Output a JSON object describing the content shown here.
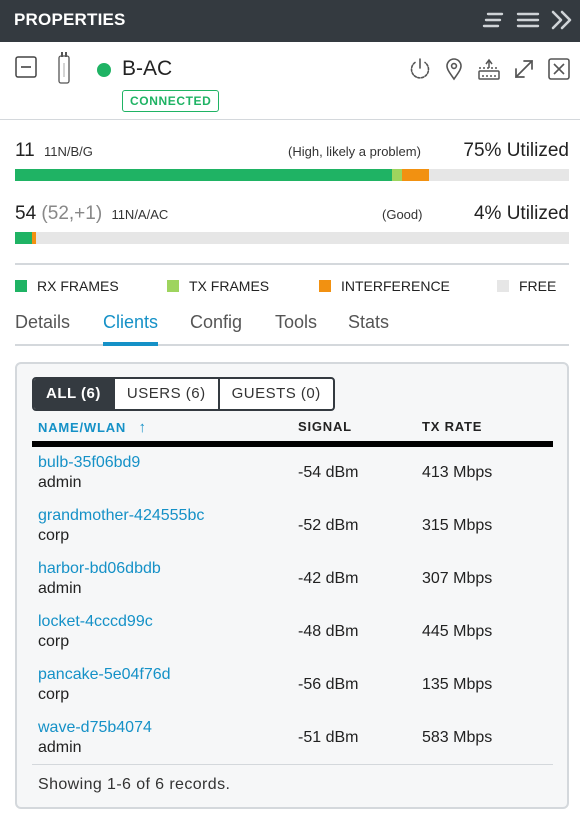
{
  "panel": {
    "title": "PROPERTIES"
  },
  "header_icons": [
    "list-filter-icon",
    "menu-icon",
    "double-chevron-right-icon"
  ],
  "device": {
    "name": "B-AC",
    "status": "CONNECTED",
    "status_color": "#1fb364",
    "actions": [
      "power-icon",
      "location-pin-icon",
      "network-switch-icon",
      "expand-icon",
      "close-icon"
    ]
  },
  "radios": [
    {
      "channel": "11",
      "extension": "",
      "mode": "11N/B/G",
      "status": "(High, likely a problem)",
      "utilized": "75% Utilized",
      "bar": {
        "rx": 0.68,
        "tx": 0.018,
        "interference": 0.05
      }
    },
    {
      "channel": "54",
      "extension": "(52,+1)",
      "mode": "11N/A/AC",
      "status": "(Good)",
      "utilized": "4% Utilized",
      "bar": {
        "rx": 0.03,
        "tx": 0.0,
        "interference": 0.008
      }
    }
  ],
  "legend": [
    {
      "label": "RX FRAMES",
      "color": "#1fb364"
    },
    {
      "label": "TX FRAMES",
      "color": "#9ed45e"
    },
    {
      "label": "INTERFERENCE",
      "color": "#f29111"
    },
    {
      "label": "FREE",
      "color": "#e6e6e6"
    }
  ],
  "tabs": [
    {
      "label": "Details",
      "active": false
    },
    {
      "label": "Clients",
      "active": true
    },
    {
      "label": "Config",
      "active": false
    },
    {
      "label": "Tools",
      "active": false
    },
    {
      "label": "Stats",
      "active": false
    }
  ],
  "clients": {
    "filters": [
      {
        "label": "ALL (6)",
        "active": true
      },
      {
        "label": "USERS (6)",
        "active": false
      },
      {
        "label": "GUESTS (0)",
        "active": false
      }
    ],
    "columns": {
      "name": "NAME/WLAN",
      "sort_indicator": "↑",
      "signal": "SIGNAL",
      "tx_rate": "TX RATE"
    },
    "rows": [
      {
        "name": "bulb-35f06bd9",
        "wlan": "admin",
        "signal": "-54 dBm",
        "tx_rate": "413 Mbps"
      },
      {
        "name": "grandmother-424555bc",
        "wlan": "corp",
        "signal": "-52 dBm",
        "tx_rate": "315 Mbps"
      },
      {
        "name": "harbor-bd06dbdb",
        "wlan": "admin",
        "signal": "-42 dBm",
        "tx_rate": "307 Mbps"
      },
      {
        "name": "locket-4cccd99c",
        "wlan": "corp",
        "signal": "-48 dBm",
        "tx_rate": "445 Mbps"
      },
      {
        "name": "pancake-5e04f76d",
        "wlan": "corp",
        "signal": "-56 dBm",
        "tx_rate": "135 Mbps"
      },
      {
        "name": "wave-d75b4074",
        "wlan": "admin",
        "signal": "-51 dBm",
        "tx_rate": "583 Mbps"
      }
    ],
    "footer": "Showing 1-6 of 6 records."
  }
}
